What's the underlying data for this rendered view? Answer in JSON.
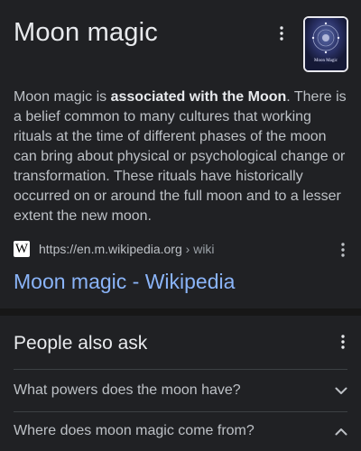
{
  "knowledge_panel": {
    "title": "Moon magic",
    "menu_icon": "more-vertical-icon",
    "thumbnail_caption": "Moon Magic",
    "description_lead": "Moon magic is ",
    "description_bold": "associated with the Moon",
    "description_rest": ". There is a belief common to many cultures that working rituals at the time of different phases of the moon can bring about physical or psychological change or transformation. These rituals have historically occurred on or around the full moon and to a lesser extent the new moon.",
    "source": {
      "icon": "W",
      "url": "https://en.m.wikipedia.org",
      "separator": " › ",
      "path": "wiki"
    },
    "result_link": "Moon magic - Wikipedia"
  },
  "people_also_ask": {
    "title": "People also ask",
    "items": [
      {
        "question": "What powers does the moon have?",
        "expanded": false
      },
      {
        "question": "Where does moon magic come from?",
        "expanded": true
      }
    ]
  },
  "colors": {
    "background": "#202124",
    "link": "#8ab4f8",
    "text_primary": "#e8eaed",
    "text_secondary": "#bdc1c6"
  }
}
